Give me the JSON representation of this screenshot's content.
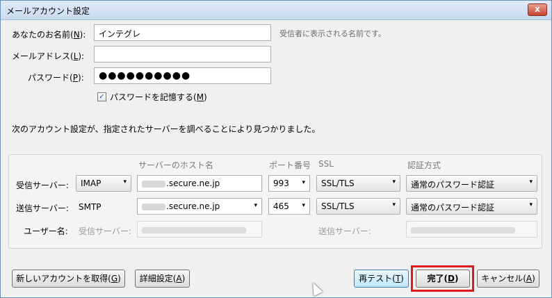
{
  "window": {
    "title": "メールアカウント設定",
    "close_label": "x"
  },
  "form": {
    "name": {
      "label": "あなたのお名前(",
      "accel": "N",
      "label_end": "):",
      "value": "インテグレ",
      "hint": "受信者に表示される名前です。"
    },
    "email": {
      "label": "メールアドレス(",
      "accel": "L",
      "label_end": "):",
      "value": ""
    },
    "password": {
      "label": "パスワード(",
      "accel": "P",
      "label_end": "):",
      "value": "●●●●●●●●●●"
    },
    "remember": {
      "label": "パスワードを記憶する(",
      "accel": "M",
      "label_end": ")",
      "checked": true,
      "check_glyph": "✓"
    }
  },
  "status_message": "次のアカウント設定が、指定されたサーバーを調べることにより見つかりました。",
  "server_table": {
    "headers": {
      "host": "サーバーのホスト名",
      "port": "ポート番号",
      "ssl": "SSL",
      "auth": "認証方式"
    },
    "incoming": {
      "label": "受信サーバー:",
      "protocol": "IMAP",
      "host": ".secure.ne.jp",
      "port": "993",
      "ssl": "SSL/TLS",
      "auth": "通常のパスワード認証"
    },
    "outgoing": {
      "label": "送信サーバー:",
      "protocol": "SMTP",
      "host": ".secure.ne.jp",
      "port": "465",
      "ssl": "SSL/TLS",
      "auth": "通常のパスワード認証"
    },
    "username": {
      "label": "ユーザー名:",
      "incoming_label": "受信サーバー:",
      "outgoing_label": "送信サーバー:"
    }
  },
  "buttons": {
    "new_account": {
      "label": "新しいアカウントを取得(",
      "accel": "G",
      "label_end": ")"
    },
    "advanced": {
      "label": "詳細設定(",
      "accel": "A",
      "label_end": ")"
    },
    "retest": {
      "label": "再テスト(",
      "accel": "T",
      "label_end": ")"
    },
    "done": {
      "label": "完了(",
      "accel": "D",
      "label_end": ")"
    },
    "cancel": {
      "label": "キャンセル(",
      "accel": "A",
      "label_end": ")"
    }
  },
  "icons": {
    "dropdown": "▾"
  },
  "colors": {
    "highlight": "#e01a1a",
    "titlebar": "#c9dbef",
    "close": "#c7462f"
  }
}
